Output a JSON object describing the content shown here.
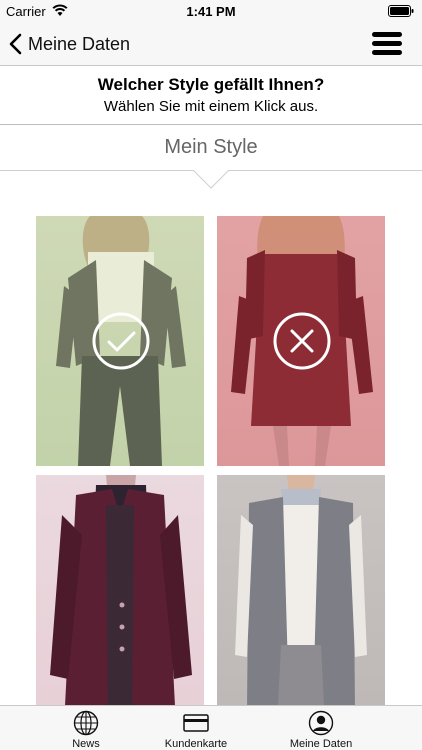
{
  "status_bar": {
    "carrier": "Carrier",
    "time": "1:41 PM"
  },
  "nav": {
    "back_label": "Meine Daten"
  },
  "headline": {
    "title": "Welcher Style gefällt Ihnen?",
    "subtitle": "Wählen Sie mit einem Klick aus."
  },
  "section": {
    "title": "Mein Style"
  },
  "styles": [
    {
      "selection": "liked",
      "overlay_icon": "checkmark-icon",
      "overlay_color": "#b5cc8f"
    },
    {
      "selection": "disliked",
      "overlay_icon": "x-icon",
      "overlay_color": "#e07c83"
    },
    {
      "selection": "none"
    },
    {
      "selection": "none"
    }
  ],
  "tabs": [
    {
      "label": "News",
      "icon": "globe-icon"
    },
    {
      "label": "Kundenkarte",
      "icon": "card-icon"
    },
    {
      "label": "Meine Daten",
      "icon": "user-icon"
    }
  ]
}
